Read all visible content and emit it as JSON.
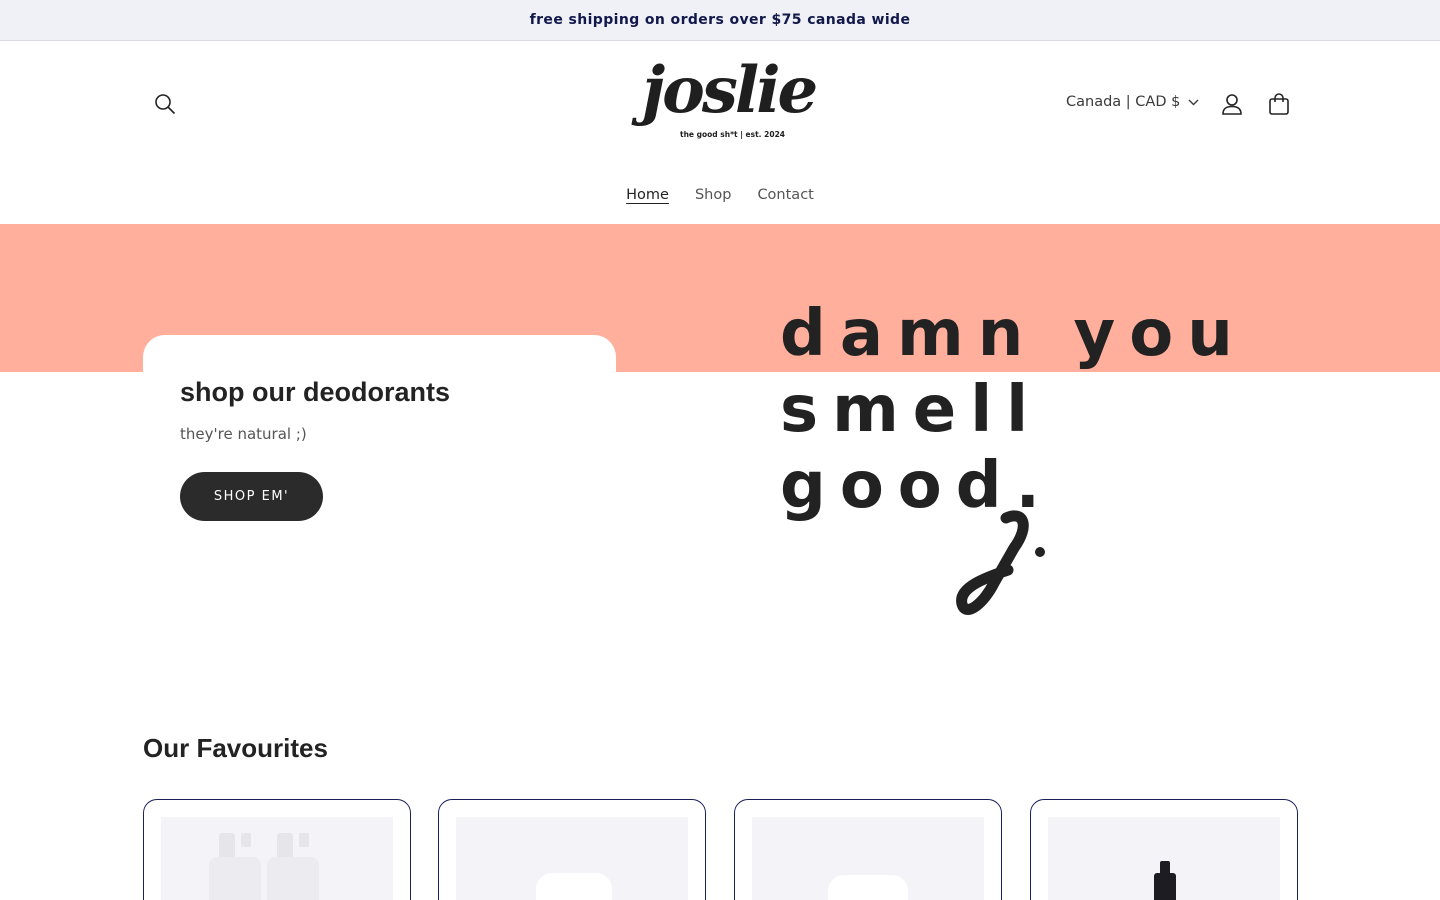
{
  "announcement": {
    "text": "free shipping on orders over $75 canada wide"
  },
  "header": {
    "logo": {
      "word": "joslie",
      "tagline": "the good sh*t | est. 2024"
    },
    "search_icon": "search-icon",
    "country_selector": {
      "label": "Canada | CAD $",
      "icon": "chevron-down-icon"
    },
    "account_icon": "user-icon",
    "cart_icon": "bag-icon"
  },
  "nav": {
    "items": [
      {
        "label": "Home",
        "active": true
      },
      {
        "label": "Shop",
        "active": false
      },
      {
        "label": "Contact",
        "active": false
      }
    ]
  },
  "hero": {
    "band_color": "#ffaf9c",
    "title": "shop our deodorants",
    "subtitle": "they're natural ;)",
    "button_label": "SHOP EM'",
    "art_lines": [
      "damn you",
      "smell",
      "good."
    ]
  },
  "favourites": {
    "title": "Our Favourites",
    "products": [
      {
        "image": "spray-bottles-pair"
      },
      {
        "image": "white-deodorant-stick"
      },
      {
        "image": "white-deodorant-stick"
      },
      {
        "image": "black-spray-bottle"
      }
    ]
  },
  "colors": {
    "accent": "#ffaf9c",
    "button": "#2b2b2b",
    "announcement_bg": "#f0f1f6",
    "announcement_text": "#11184a",
    "card_border": "#1b1f5a"
  }
}
